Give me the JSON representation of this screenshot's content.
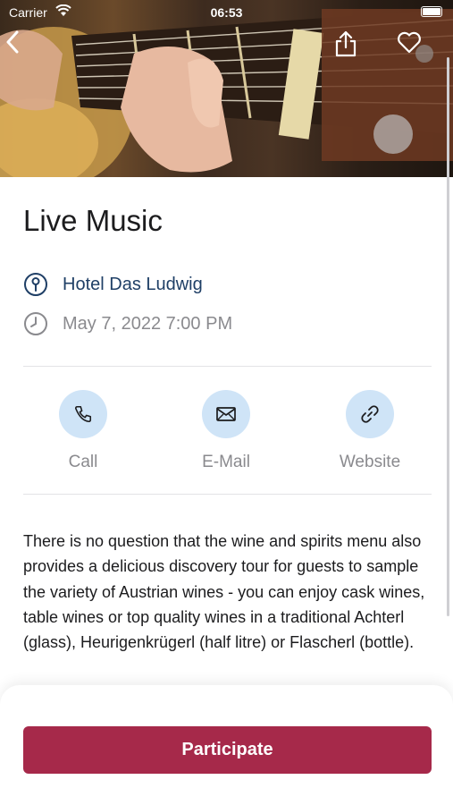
{
  "status_bar": {
    "carrier": "Carrier",
    "time": "06:53"
  },
  "event": {
    "title": "Live Music",
    "location": "Hotel Das Ludwig",
    "datetime": "May 7, 2022 7:00 PM",
    "description": "There is no question that the wine and spirits menu also provides a delicious discovery tour for guests to sample the variety of Austrian wines - you can enjoy cask wines, table wines or top quality wines in a traditional Achterl (glass), Heurigenkrügerl (half litre) or Flascherl (bottle)."
  },
  "actions": {
    "call": "Call",
    "email": "E-Mail",
    "website": "Website"
  },
  "participate_label": "Participate",
  "icons": [
    "back-icon",
    "share-icon",
    "heart-icon",
    "location-pin-icon",
    "clock-icon",
    "phone-icon",
    "mail-icon",
    "link-icon"
  ],
  "colors": {
    "accent": "#a6294a",
    "link": "#1f3f66",
    "action_bg": "#cfe4f7",
    "muted": "#8a8a8e"
  }
}
